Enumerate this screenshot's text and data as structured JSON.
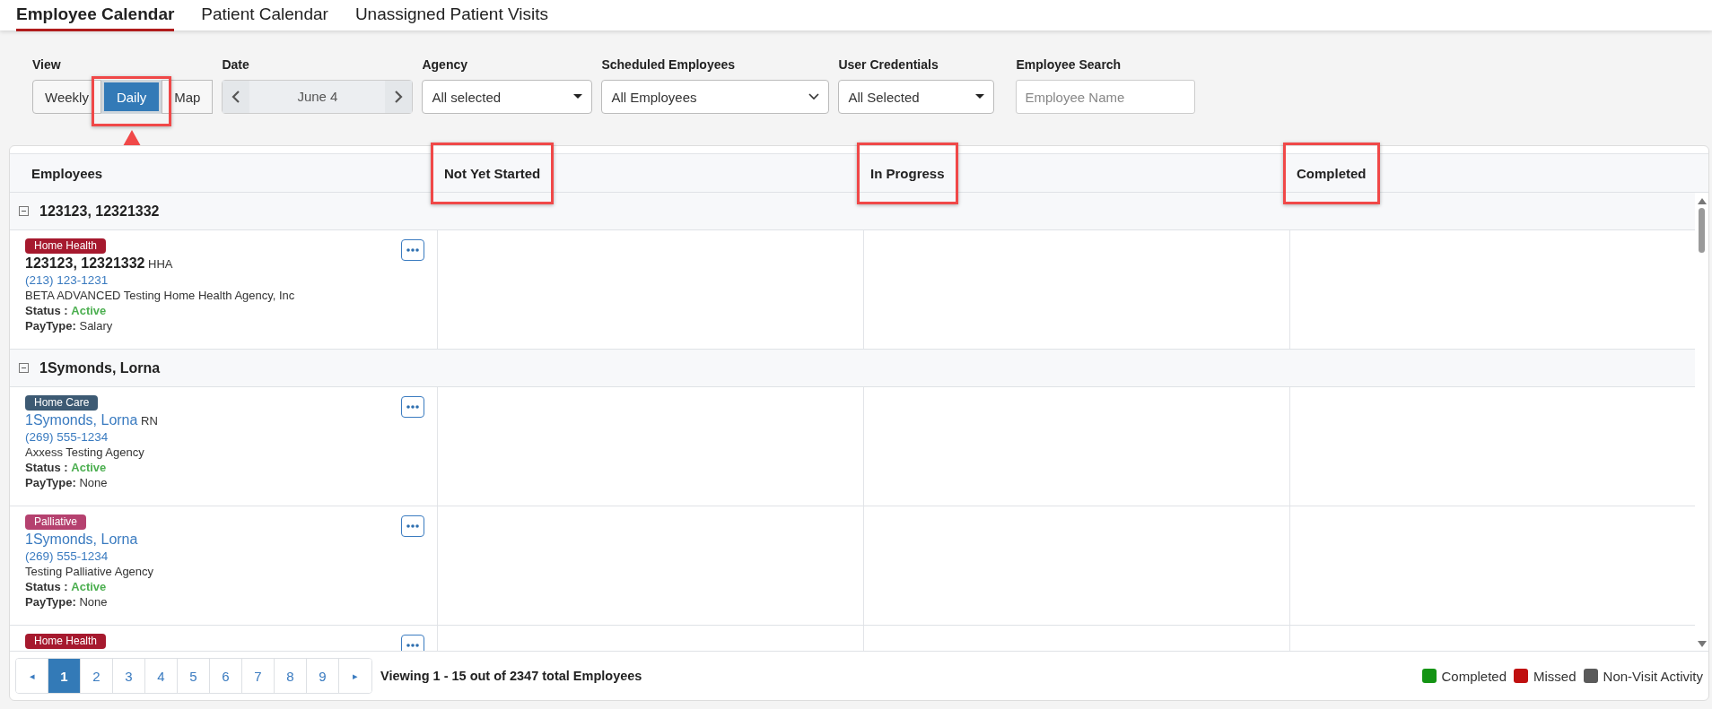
{
  "tabs": [
    {
      "label": "Employee Calendar",
      "selected": true
    },
    {
      "label": "Patient Calendar",
      "selected": false
    },
    {
      "label": "Unassigned Patient Visits",
      "selected": false
    }
  ],
  "filters": {
    "view": {
      "label": "View",
      "options": [
        {
          "label": "Weekly",
          "selected": false,
          "highlighted": false
        },
        {
          "label": "Daily",
          "selected": true,
          "highlighted": true
        },
        {
          "label": "Map",
          "selected": false,
          "highlighted": false
        }
      ]
    },
    "date": {
      "label": "Date",
      "value": "June 4"
    },
    "dropdowns": [
      {
        "label": "Agency",
        "value": "All selected",
        "kind": "caret"
      },
      {
        "label": "Scheduled Employees",
        "value": "All Employees",
        "kind": "chevron"
      },
      {
        "label": "User Credentials",
        "value": "All Selected",
        "kind": "caret"
      }
    ],
    "search": {
      "label": "Employee Search",
      "placeholder": "Employee Name"
    }
  },
  "table": {
    "columns": [
      {
        "label": "Employees",
        "highlighted": false
      },
      {
        "label": "Not Yet Started",
        "highlighted": true
      },
      {
        "label": "In Progress",
        "highlighted": true
      },
      {
        "label": "Completed",
        "highlighted": true
      }
    ],
    "groups": [
      {
        "name": "123123, 12321332",
        "expanded": true,
        "employees": [
          {
            "tag": {
              "label": "Home Health",
              "color": "#a6192e"
            },
            "name": "123123, 12321332",
            "linked": false,
            "credential": "HHA",
            "phone": "(213) 123-1231",
            "agency": "BETA ADVANCED Testing Home Health Agency, Inc",
            "status_label": "Status :",
            "status": "Active",
            "paytype_label": "PayType:",
            "paytype": "Salary"
          }
        ]
      },
      {
        "name": "1Symonds, Lorna",
        "expanded": true,
        "employees": [
          {
            "tag": {
              "label": "Home Care",
              "color": "#3d5a73"
            },
            "name": "1Symonds, Lorna",
            "linked": true,
            "credential": "RN",
            "phone": "(269) 555-1234",
            "agency": "Axxess Testing Agency",
            "status_label": "Status :",
            "status": "Active",
            "paytype_label": "PayType:",
            "paytype": "None"
          },
          {
            "tag": {
              "label": "Palliative",
              "color": "#b5416f"
            },
            "name": "1Symonds, Lorna",
            "linked": true,
            "phone": "(269) 555-1234",
            "agency": "Testing Palliative Agency",
            "status_label": "Status :",
            "status": "Active",
            "paytype_label": "PayType:",
            "paytype": "None"
          },
          {
            "tag": {
              "label": "Home Health",
              "color": "#a6192e"
            }
          }
        ]
      }
    ]
  },
  "pagination": {
    "prev": "◂",
    "pages": [
      {
        "label": "1",
        "selected": true
      },
      {
        "label": "2",
        "selected": false
      },
      {
        "label": "3",
        "selected": false
      },
      {
        "label": "4",
        "selected": false
      },
      {
        "label": "5",
        "selected": false
      },
      {
        "label": "6",
        "selected": false
      },
      {
        "label": "7",
        "selected": false
      },
      {
        "label": "8",
        "selected": false
      },
      {
        "label": "9",
        "selected": false
      }
    ],
    "next": "▸",
    "summary": "Viewing 1 - 15 out of 2347 total Employees"
  },
  "legend": [
    {
      "label": "Completed",
      "color": "#149414"
    },
    {
      "label": "Missed",
      "color": "#c01010"
    },
    {
      "label": "Non-Visit Activity",
      "color": "#5a5a5a"
    }
  ]
}
